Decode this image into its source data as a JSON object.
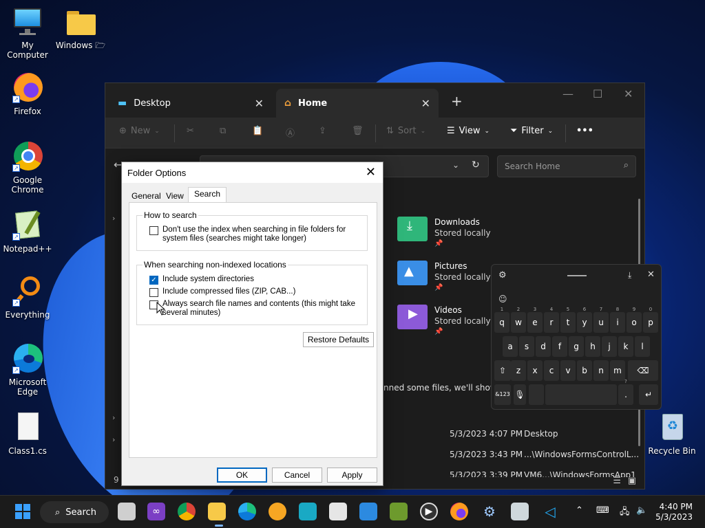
{
  "desktop": {
    "icons": [
      {
        "label": "My Computer"
      },
      {
        "label": "Windows 🗁"
      },
      {
        "label": "Firefox"
      },
      {
        "label": "Google Chrome"
      },
      {
        "label": "Notepad++"
      },
      {
        "label": "Everything"
      },
      {
        "label": "Microsoft Edge"
      },
      {
        "label": "Class1.cs"
      },
      {
        "label": "Recycle Bin"
      }
    ]
  },
  "explorer": {
    "tabs": [
      {
        "label": "Desktop"
      },
      {
        "label": "Home"
      }
    ],
    "toolbar": {
      "new_label": "New",
      "sort_label": "Sort",
      "view_label": "View",
      "filter_label": "Filter",
      "more_label": "•••"
    },
    "search_placeholder": "Search Home",
    "quick_access": [
      {
        "name": "Downloads",
        "sub": "Stored locally",
        "color": "#2fb67a"
      },
      {
        "name": "Pictures",
        "sub": "Stored locally",
        "color": "#3a8ee6"
      },
      {
        "name": "Videos",
        "sub": "Stored locally",
        "color": "#8c5ad8"
      }
    ],
    "recent_note": "nned some files, we'll show the",
    "recent_rows": [
      {
        "date": "5/3/2023 4:07 PM",
        "location": "Desktop"
      },
      {
        "date": "5/3/2023 3:43 PM",
        "location": "...\\WindowsFormsControlL..."
      },
      {
        "date": "5/3/2023 3:39 PM",
        "location": "VM6...\\WindowsFormsApp1"
      }
    ],
    "status_count": "9"
  },
  "dialog": {
    "title": "Folder Options",
    "tabs": [
      "General",
      "View",
      "Search"
    ],
    "how_to_search": {
      "title": "How to search",
      "option": "Don't use the index when searching in file folders for system files (searches might take longer)",
      "checked": false
    },
    "non_indexed": {
      "title": "When searching non-indexed locations",
      "options": [
        {
          "label": "Include system directories",
          "checked": true
        },
        {
          "label": "Include compressed files (ZIP, CAB...)",
          "checked": false
        },
        {
          "label": "Always search file names and contents (this might take several minutes)",
          "checked": false
        }
      ]
    },
    "restore_label": "Restore Defaults",
    "ok_label": "OK",
    "cancel_label": "Cancel",
    "apply_label": "Apply"
  },
  "keyboard": {
    "row1": [
      [
        "q",
        "1"
      ],
      [
        "w",
        "2"
      ],
      [
        "e",
        "3"
      ],
      [
        "r",
        "4"
      ],
      [
        "t",
        "5"
      ],
      [
        "y",
        "6"
      ],
      [
        "u",
        "7"
      ],
      [
        "i",
        "8"
      ],
      [
        "o",
        "9"
      ],
      [
        "p",
        "0"
      ]
    ],
    "row2": [
      "a",
      "s",
      "d",
      "f",
      "g",
      "h",
      "j",
      "k",
      "l"
    ],
    "row3": [
      "z",
      "x",
      "c",
      "v",
      "b",
      "n",
      "m"
    ],
    "symbols_label": "&123",
    "period_label": ".",
    "period_alt": "?"
  },
  "taskbar": {
    "search_label": "Search",
    "time": "4:40 PM",
    "date": "5/3/2023"
  }
}
